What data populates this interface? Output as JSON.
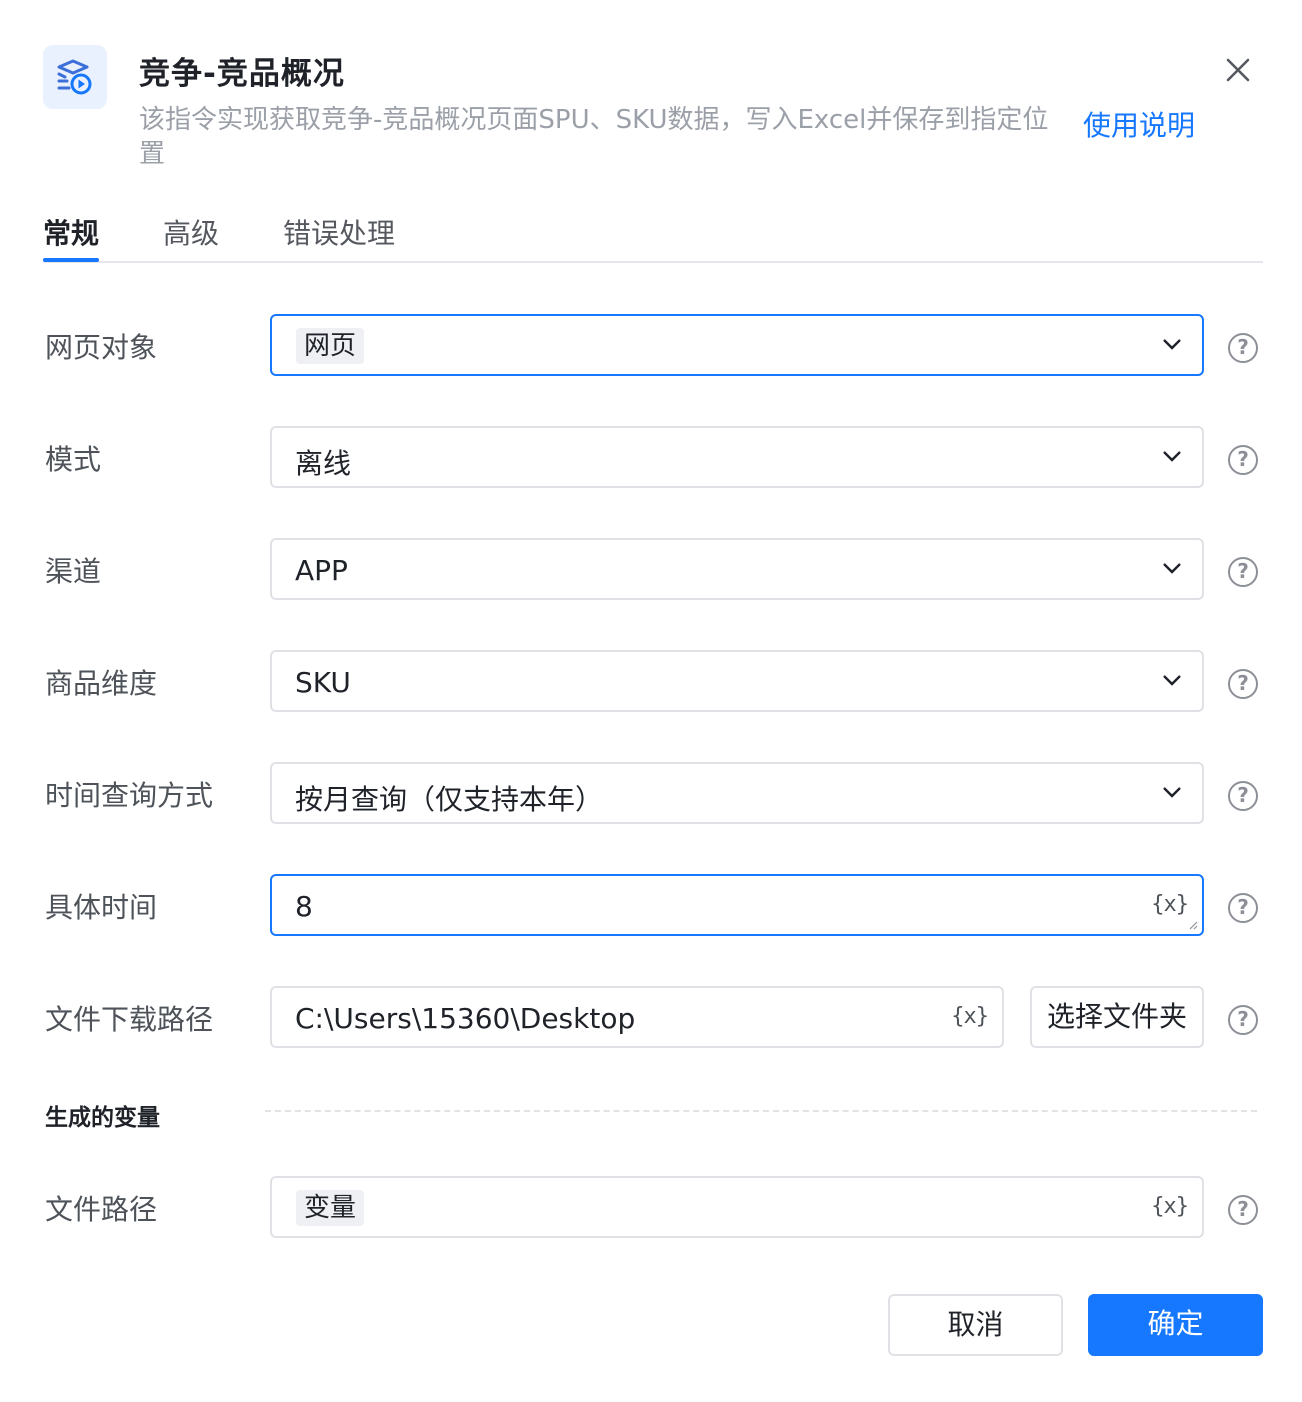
{
  "header": {
    "icon": "command-icon",
    "title": "竞争-竞品概况",
    "description": "该指令实现获取竞争-竞品概况页面SPU、SKU数据，写入Excel并保存到指定位置",
    "help_link": "使用说明",
    "close_icon": "close-icon"
  },
  "tabs": [
    {
      "label": "常规",
      "active": true
    },
    {
      "label": "高级",
      "active": false
    },
    {
      "label": "错误处理",
      "active": false
    }
  ],
  "form": {
    "web_object": {
      "label": "网页对象",
      "value": "网页"
    },
    "mode": {
      "label": "模式",
      "value": "离线"
    },
    "channel": {
      "label": "渠道",
      "value": "APP"
    },
    "dimension": {
      "label": "商品维度",
      "value": "SKU"
    },
    "time_query": {
      "label": "时间查询方式",
      "value": "按月查询（仅支持本年）"
    },
    "specific_time": {
      "label": "具体时间",
      "value": "8"
    },
    "download_path": {
      "label": "文件下载路径",
      "value": "C:\\Users\\15360\\Desktop",
      "button": "选择文件夹"
    }
  },
  "variable_symbol": "{x}",
  "help_symbol": "?",
  "output": {
    "section_title": "生成的变量",
    "file_path": {
      "label": "文件路径",
      "value": "变量"
    }
  },
  "footer": {
    "cancel": "取消",
    "confirm": "确定"
  },
  "colors": {
    "accent": "#1677ff",
    "icon_bg": "#eaf1fe",
    "border": "#dfe1e5"
  }
}
